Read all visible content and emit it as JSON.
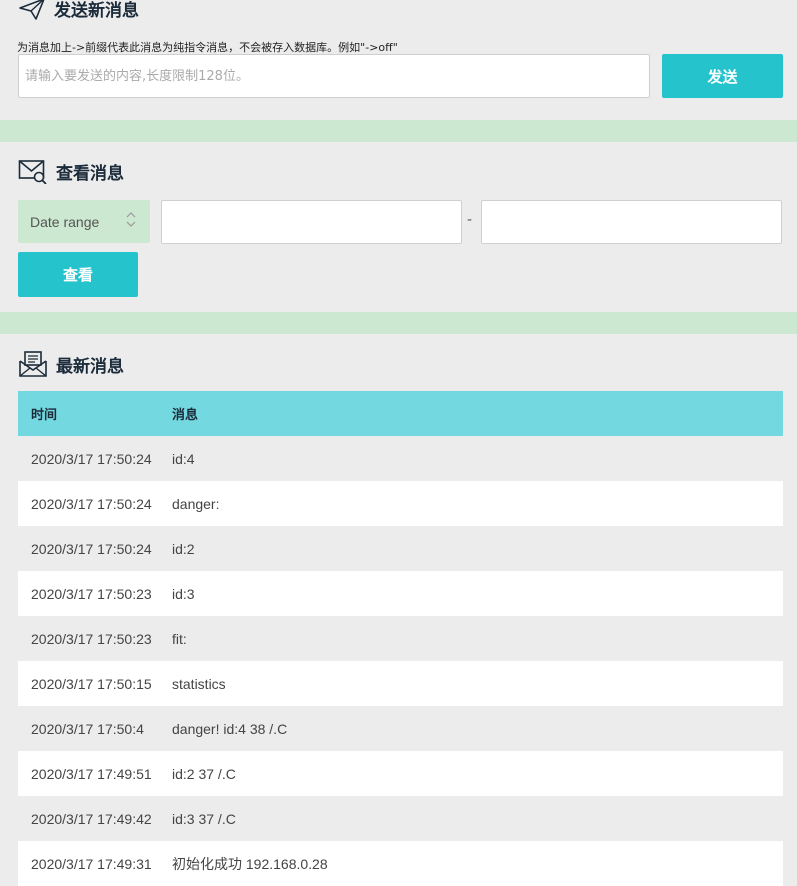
{
  "send": {
    "title": "发送新消息",
    "hint": "为消息加上->前缀代表此消息为纯指令消息，不会被存入数据库。例如\"->off\"",
    "placeholder": "请输入要发送的内容,长度限制128位。",
    "button": "发送",
    "icon": "paper-plane-icon"
  },
  "view": {
    "title": "查看消息",
    "date_range_label": "Date range",
    "dash": "-",
    "button": "查看",
    "icon": "envelope-search-icon"
  },
  "latest": {
    "title": "最新消息",
    "icon": "mail-inbox-icon",
    "columns": [
      "时间",
      "消息"
    ],
    "rows": [
      [
        "2020/3/17 17:50:24",
        "id:4"
      ],
      [
        "2020/3/17 17:50:24",
        "danger:"
      ],
      [
        "2020/3/17 17:50:24",
        "id:2"
      ],
      [
        "2020/3/17 17:50:23",
        "id:3"
      ],
      [
        "2020/3/17 17:50:23",
        "fit:"
      ],
      [
        "2020/3/17 17:50:15",
        "statistics"
      ],
      [
        "2020/3/17 17:50:4",
        "danger! id:4 38 /.C"
      ],
      [
        "2020/3/17 17:49:51",
        "id:2 37 /.C"
      ],
      [
        "2020/3/17 17:49:42",
        "id:3 37 /.C"
      ],
      [
        "2020/3/17 17:49:31",
        "初始化成功 192.168.0.28"
      ]
    ]
  },
  "colors": {
    "accent": "#25c3cc",
    "header": "#73d8df",
    "separator": "#cce8d0",
    "background": "#ececec"
  }
}
